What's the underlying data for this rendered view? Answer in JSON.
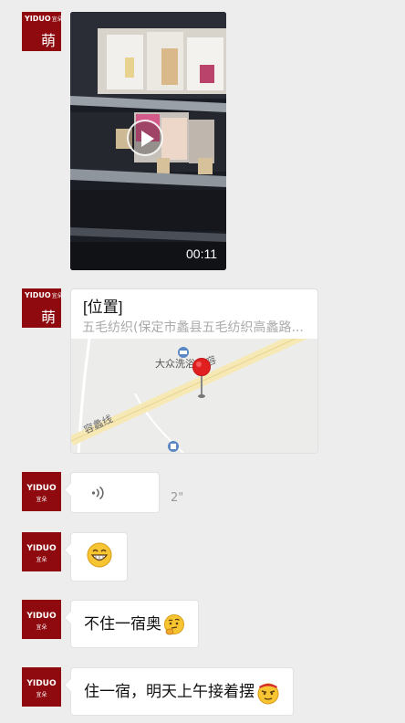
{
  "avatar": {
    "brand": "YIDUO",
    "brand_cn": "宜朵",
    "glyph": "萌"
  },
  "video": {
    "duration": "00:11"
  },
  "location": {
    "title": "[位置]",
    "address": "五毛纺织(保定市蠡县五毛纺织高蠡路...",
    "map_labels": {
      "poi": "大众洗浴",
      "road_diag": "容蠡线",
      "road_top": "容"
    }
  },
  "voice": {
    "length": "2\""
  },
  "messages": {
    "text1": "不住一宿奥",
    "text2": "住一宿，明天上午接着摆"
  },
  "icons": {
    "play": "play-icon",
    "voice": "voice-wave-icon",
    "pin": "map-pin-icon",
    "grin": "grin-emoji",
    "thinking": "thinking-emoji",
    "determined": "determined-emoji"
  },
  "colors": {
    "background": "#ededed",
    "avatar": "#8e0a0e",
    "pin": "#e02020",
    "bubble": "#ffffff"
  }
}
